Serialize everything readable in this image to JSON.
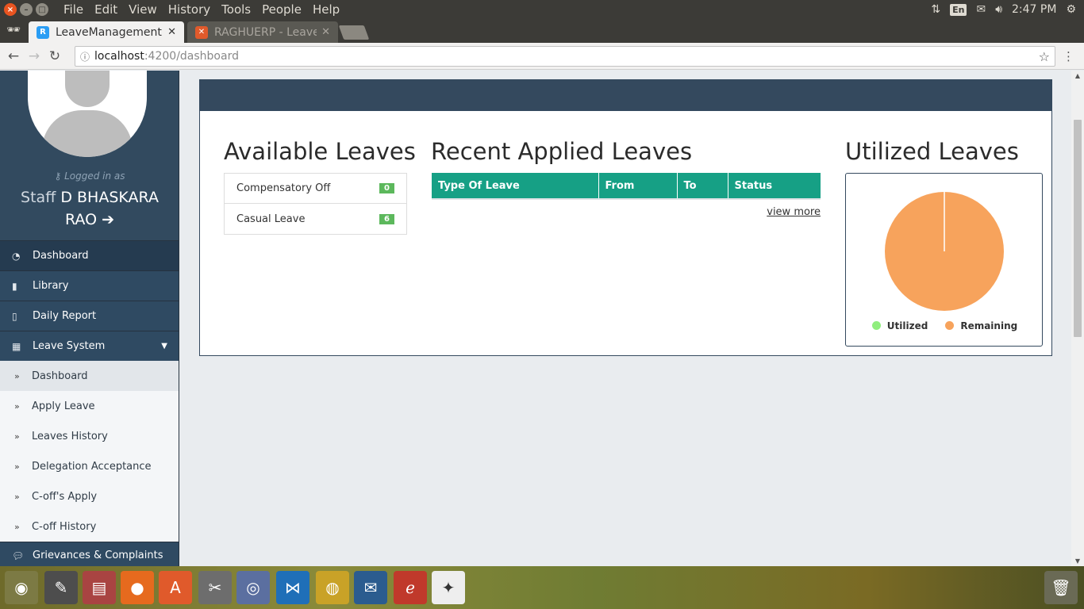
{
  "system_bar": {
    "menus": [
      "File",
      "Edit",
      "View",
      "History",
      "Tools",
      "People",
      "Help"
    ],
    "keyboard_layout": "En",
    "time": "2:47 PM"
  },
  "tabs": [
    {
      "title": "LeaveManagement",
      "active": true
    },
    {
      "title": "RAGHUERP - Leave",
      "active": false
    }
  ],
  "address": {
    "host": "localhost",
    "path": ":4200/dashboard"
  },
  "profile": {
    "logged_in_label": "Logged in as",
    "role": "Staff",
    "name_line1": "D BHASKARA",
    "name_line2": "RAO"
  },
  "sidebar": {
    "items": [
      {
        "label": "Dashboard",
        "icon": "dashboard-icon"
      },
      {
        "label": "Library",
        "icon": "book-icon"
      },
      {
        "label": "Daily Report",
        "icon": "file-icon"
      },
      {
        "label": "Leave System",
        "icon": "calendar-icon"
      }
    ],
    "leave_sub": [
      {
        "label": "Dashboard"
      },
      {
        "label": "Apply Leave"
      },
      {
        "label": "Leaves History"
      },
      {
        "label": "Delegation Acceptance"
      },
      {
        "label": "C-off's Apply"
      },
      {
        "label": "C-off History"
      }
    ],
    "grievances": "Grievances & Complaints"
  },
  "available": {
    "title": "Available Leaves",
    "rows": [
      {
        "label": "Compensatory Off",
        "count": "0"
      },
      {
        "label": "Casual Leave",
        "count": "6"
      }
    ]
  },
  "recent": {
    "title": "Recent Applied Leaves",
    "columns": [
      "Type Of Leave",
      "From",
      "To",
      "Status"
    ],
    "view_more": "view more"
  },
  "utilized": {
    "title": "Utilized Leaves"
  },
  "chart_data": {
    "type": "pie",
    "labels": [
      "Utilized",
      "Remaining"
    ],
    "values": [
      0,
      6
    ],
    "colors": [
      "#90ee7e",
      "#f7a35c"
    ]
  },
  "colors": {
    "sidebar": "#2f4050",
    "card_header": "#34495e",
    "table_header": "#16a085",
    "badge": "#5cb85c"
  }
}
